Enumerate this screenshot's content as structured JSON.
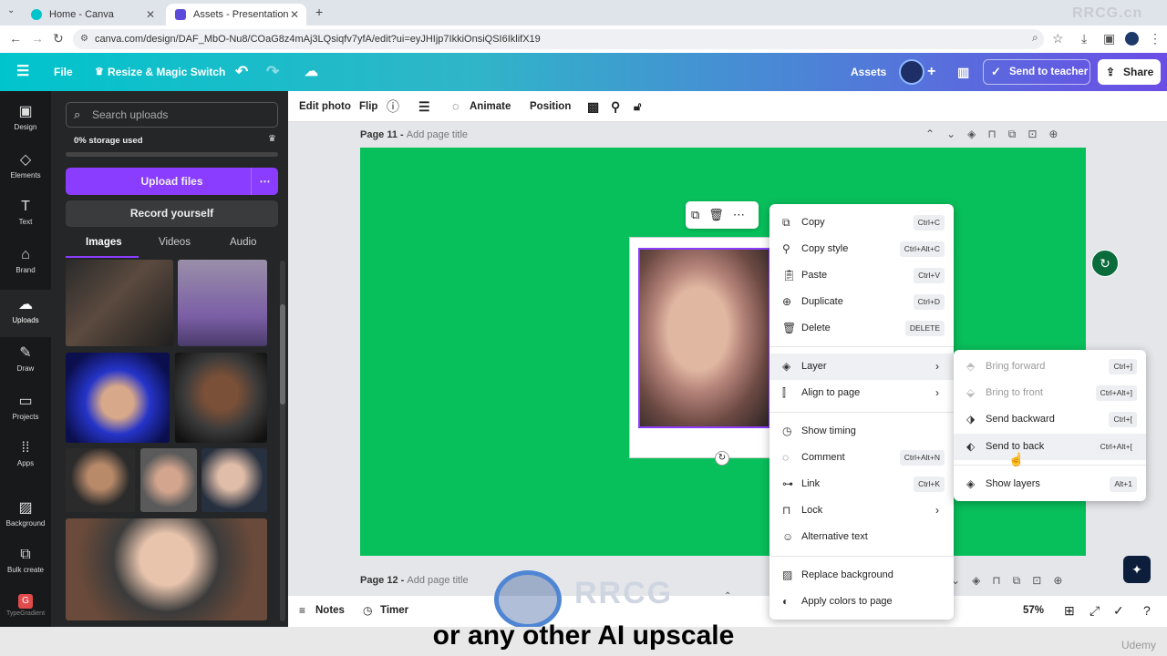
{
  "browser": {
    "tabs": [
      {
        "label": "Home - Canva"
      },
      {
        "label": "Assets - Presentation"
      }
    ],
    "url": "canva.com/design/DAF_MbO-Nu8/COaG8z4mAj3LQsiqfv7yfA/edit?ui=eyJHIjp7IkkiOnsiQSI6IklifX19"
  },
  "topbar": {
    "file": "File",
    "resize": "Resize & Magic Switch",
    "assets": "Assets",
    "send_to_teacher": "Send to teacher",
    "share": "Share",
    "accent": "#8b3dff"
  },
  "leftnav": [
    {
      "label": "Design",
      "icon": "design-icon"
    },
    {
      "label": "Elements",
      "icon": "elements-icon"
    },
    {
      "label": "Text",
      "icon": "text-icon"
    },
    {
      "label": "Brand",
      "icon": "brand-icon"
    },
    {
      "label": "Uploads",
      "icon": "uploads-icon"
    },
    {
      "label": "Draw",
      "icon": "draw-icon"
    },
    {
      "label": "Projects",
      "icon": "projects-icon"
    },
    {
      "label": "Apps",
      "icon": "apps-icon"
    },
    {
      "label": "Background",
      "icon": "background-icon"
    },
    {
      "label": "Bulk create",
      "icon": "bulk-create-icon"
    },
    {
      "label": "TypeGradient",
      "icon": "typegradient-icon"
    }
  ],
  "panel": {
    "search_placeholder": "Search uploads",
    "storage": "0% storage used",
    "upload": "Upload files",
    "record": "Record yourself",
    "tabs": [
      "Images",
      "Videos",
      "Audio"
    ]
  },
  "toolbar": {
    "edit_photo": "Edit photo",
    "flip": "Flip",
    "animate": "Animate",
    "position": "Position"
  },
  "pages": [
    {
      "label": "Page 11 -",
      "title_placeholder": "Add page title"
    },
    {
      "label": "Page 12 -",
      "title_placeholder": "Add page title"
    }
  ],
  "context_menu": [
    {
      "label": "Copy",
      "shortcut": "Ctrl+C"
    },
    {
      "label": "Copy style",
      "shortcut": "Ctrl+Alt+C"
    },
    {
      "label": "Paste",
      "shortcut": "Ctrl+V"
    },
    {
      "label": "Duplicate",
      "shortcut": "Ctrl+D"
    },
    {
      "label": "Delete",
      "shortcut": "DELETE"
    },
    {
      "label": "Layer"
    },
    {
      "label": "Align to page"
    },
    {
      "label": "Show timing"
    },
    {
      "label": "Comment",
      "shortcut": "Ctrl+Alt+N"
    },
    {
      "label": "Link",
      "shortcut": "Ctrl+K"
    },
    {
      "label": "Lock"
    },
    {
      "label": "Alternative text"
    },
    {
      "label": "Replace background"
    },
    {
      "label": "Apply colors to page"
    }
  ],
  "layer_submenu": [
    {
      "label": "Bring forward",
      "shortcut": "Ctrl+]"
    },
    {
      "label": "Bring to front",
      "shortcut": "Ctrl+Alt+]"
    },
    {
      "label": "Send backward",
      "shortcut": "Ctrl+["
    },
    {
      "label": "Send to back",
      "shortcut": "Ctrl+Alt+["
    },
    {
      "label": "Show layers",
      "shortcut": "Alt+1"
    }
  ],
  "bottombar": {
    "notes": "Notes",
    "timer": "Timer",
    "zoom": "57%"
  },
  "caption": "or any other AI upscale",
  "watermarks": {
    "site": "RRCG.cn",
    "brand": "RRCG",
    "platform": "Udemy"
  }
}
